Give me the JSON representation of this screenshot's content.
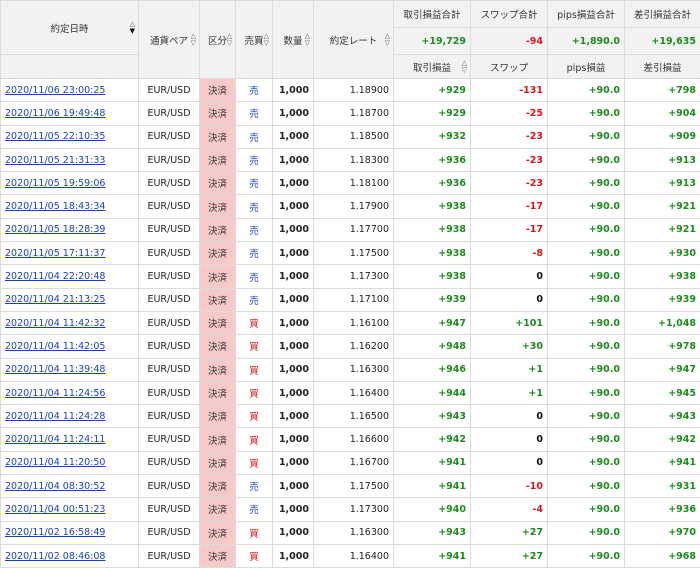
{
  "header": {
    "date": "約定日時",
    "pair": "通貨ペア",
    "kubun": "区分",
    "baibai": "売買",
    "qty": "数量",
    "rate": "約定レート",
    "pl_total": "取引損益合計",
    "swap_total": "スワップ合計",
    "pips_total": "pips損益合計",
    "net_total": "差引損益合計",
    "pl": "取引損益",
    "swap": "スワップ",
    "pips": "pips損益",
    "net": "差引損益",
    "sort_up": "△",
    "sort_down": "▽",
    "sort_down_active": "▼"
  },
  "totals": {
    "pl": "+19,729",
    "swap": "-94",
    "pips": "+1,890.0",
    "net": "+19,635"
  },
  "rows": [
    {
      "date": "2020/11/06 23:00:25",
      "pair": "EUR/USD",
      "kubun": "決済",
      "side": "売",
      "qty": "1,000",
      "rate": "1.18900",
      "pl": "+929",
      "swap": "-131",
      "pips": "+90.0",
      "net": "+798"
    },
    {
      "date": "2020/11/06 19:49:48",
      "pair": "EUR/USD",
      "kubun": "決済",
      "side": "売",
      "qty": "1,000",
      "rate": "1.18700",
      "pl": "+929",
      "swap": "-25",
      "pips": "+90.0",
      "net": "+904"
    },
    {
      "date": "2020/11/05 22:10:35",
      "pair": "EUR/USD",
      "kubun": "決済",
      "side": "売",
      "qty": "1,000",
      "rate": "1.18500",
      "pl": "+932",
      "swap": "-23",
      "pips": "+90.0",
      "net": "+909"
    },
    {
      "date": "2020/11/05 21:31:33",
      "pair": "EUR/USD",
      "kubun": "決済",
      "side": "売",
      "qty": "1,000",
      "rate": "1.18300",
      "pl": "+936",
      "swap": "-23",
      "pips": "+90.0",
      "net": "+913"
    },
    {
      "date": "2020/11/05 19:59:06",
      "pair": "EUR/USD",
      "kubun": "決済",
      "side": "売",
      "qty": "1,000",
      "rate": "1.18100",
      "pl": "+936",
      "swap": "-23",
      "pips": "+90.0",
      "net": "+913"
    },
    {
      "date": "2020/11/05 18:43:34",
      "pair": "EUR/USD",
      "kubun": "決済",
      "side": "売",
      "qty": "1,000",
      "rate": "1.17900",
      "pl": "+938",
      "swap": "-17",
      "pips": "+90.0",
      "net": "+921"
    },
    {
      "date": "2020/11/05 18:28:39",
      "pair": "EUR/USD",
      "kubun": "決済",
      "side": "売",
      "qty": "1,000",
      "rate": "1.17700",
      "pl": "+938",
      "swap": "-17",
      "pips": "+90.0",
      "net": "+921"
    },
    {
      "date": "2020/11/05 17:11:37",
      "pair": "EUR/USD",
      "kubun": "決済",
      "side": "売",
      "qty": "1,000",
      "rate": "1.17500",
      "pl": "+938",
      "swap": "-8",
      "pips": "+90.0",
      "net": "+930"
    },
    {
      "date": "2020/11/04 22:20:48",
      "pair": "EUR/USD",
      "kubun": "決済",
      "side": "売",
      "qty": "1,000",
      "rate": "1.17300",
      "pl": "+938",
      "swap": "0",
      "pips": "+90.0",
      "net": "+938"
    },
    {
      "date": "2020/11/04 21:13:25",
      "pair": "EUR/USD",
      "kubun": "決済",
      "side": "売",
      "qty": "1,000",
      "rate": "1.17100",
      "pl": "+939",
      "swap": "0",
      "pips": "+90.0",
      "net": "+939"
    },
    {
      "date": "2020/11/04 11:42:32",
      "pair": "EUR/USD",
      "kubun": "決済",
      "side": "買",
      "qty": "1,000",
      "rate": "1.16100",
      "pl": "+947",
      "swap": "+101",
      "pips": "+90.0",
      "net": "+1,048"
    },
    {
      "date": "2020/11/04 11:42:05",
      "pair": "EUR/USD",
      "kubun": "決済",
      "side": "買",
      "qty": "1,000",
      "rate": "1.16200",
      "pl": "+948",
      "swap": "+30",
      "pips": "+90.0",
      "net": "+978"
    },
    {
      "date": "2020/11/04 11:39:48",
      "pair": "EUR/USD",
      "kubun": "決済",
      "side": "買",
      "qty": "1,000",
      "rate": "1.16300",
      "pl": "+946",
      "swap": "+1",
      "pips": "+90.0",
      "net": "+947"
    },
    {
      "date": "2020/11/04 11:24:56",
      "pair": "EUR/USD",
      "kubun": "決済",
      "side": "買",
      "qty": "1,000",
      "rate": "1.16400",
      "pl": "+944",
      "swap": "+1",
      "pips": "+90.0",
      "net": "+945"
    },
    {
      "date": "2020/11/04 11:24:28",
      "pair": "EUR/USD",
      "kubun": "決済",
      "side": "買",
      "qty": "1,000",
      "rate": "1.16500",
      "pl": "+943",
      "swap": "0",
      "pips": "+90.0",
      "net": "+943"
    },
    {
      "date": "2020/11/04 11:24:11",
      "pair": "EUR/USD",
      "kubun": "決済",
      "side": "買",
      "qty": "1,000",
      "rate": "1.16600",
      "pl": "+942",
      "swap": "0",
      "pips": "+90.0",
      "net": "+942"
    },
    {
      "date": "2020/11/04 11:20:50",
      "pair": "EUR/USD",
      "kubun": "決済",
      "side": "買",
      "qty": "1,000",
      "rate": "1.16700",
      "pl": "+941",
      "swap": "0",
      "pips": "+90.0",
      "net": "+941"
    },
    {
      "date": "2020/11/04 08:30:52",
      "pair": "EUR/USD",
      "kubun": "決済",
      "side": "売",
      "qty": "1,000",
      "rate": "1.17500",
      "pl": "+941",
      "swap": "-10",
      "pips": "+90.0",
      "net": "+931"
    },
    {
      "date": "2020/11/04 00:51:23",
      "pair": "EUR/USD",
      "kubun": "決済",
      "side": "売",
      "qty": "1,000",
      "rate": "1.17300",
      "pl": "+940",
      "swap": "-4",
      "pips": "+90.0",
      "net": "+936"
    },
    {
      "date": "2020/11/02 16:58:49",
      "pair": "EUR/USD",
      "kubun": "決済",
      "side": "買",
      "qty": "1,000",
      "rate": "1.16300",
      "pl": "+943",
      "swap": "+27",
      "pips": "+90.0",
      "net": "+970"
    },
    {
      "date": "2020/11/02 08:46:08",
      "pair": "EUR/USD",
      "kubun": "決済",
      "side": "買",
      "qty": "1,000",
      "rate": "1.16400",
      "pl": "+941",
      "swap": "+27",
      "pips": "+90.0",
      "net": "+968"
    }
  ]
}
